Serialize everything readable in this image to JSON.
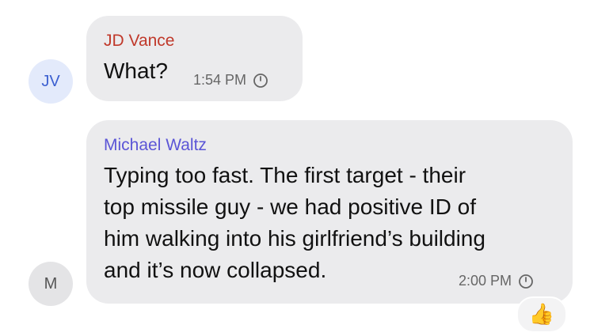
{
  "conversation": {
    "messages": [
      {
        "avatar_initials": "JV",
        "sender": "JD Vance",
        "text_lines": [
          "What?"
        ],
        "time": "1:54 PM",
        "sender_color": "#c0392b"
      },
      {
        "avatar_initials": "M",
        "sender": "Michael Waltz",
        "text_lines": [
          "Typing too fast. The first target - their",
          "top missile guy - we had positive ID of",
          "him walking into his girlfriend’s building",
          "and it’s now collapsed."
        ],
        "time": "2:00 PM",
        "sender_color": "#5b55d6",
        "reaction": "👍",
        "reaction_icon": "thumbs-up-icon"
      }
    ]
  }
}
